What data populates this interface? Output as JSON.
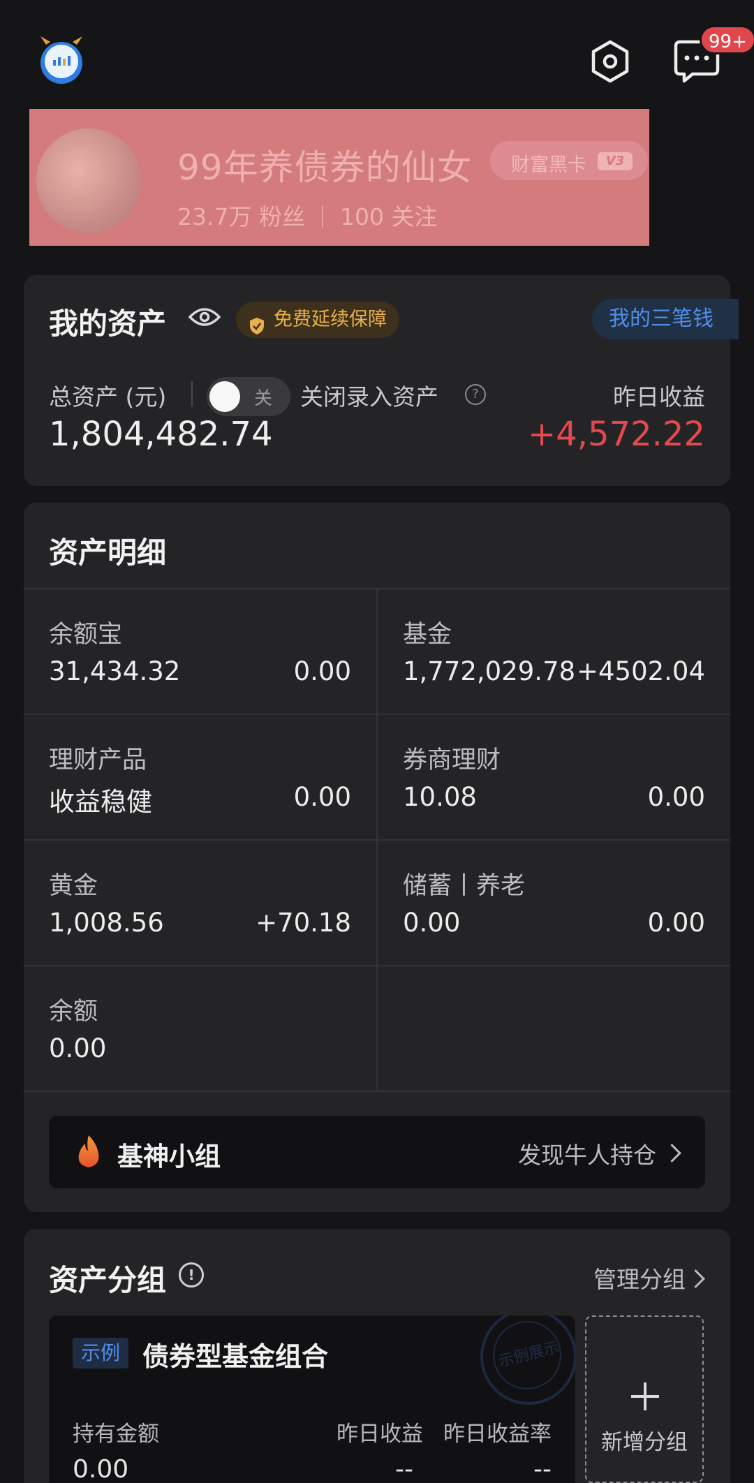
{
  "header": {
    "message_badge": "99+"
  },
  "profile": {
    "name": "99年养债券的仙女",
    "vip_label": "财富黑卡",
    "vip_level": "V3",
    "fans": "23.7万 粉丝",
    "following": "100 关注"
  },
  "assets": {
    "title": "我的资产",
    "guarantee": "免费延续保障",
    "three_money": "我的三笔钱",
    "total_label": "总资产 (元)",
    "toggle_label": "关",
    "toggle_desc": "关闭录入资产",
    "help": "?",
    "total_value": "1,804,482.74",
    "yesterday_label": "昨日收益",
    "yesterday_value": "+4,572.22"
  },
  "detail": {
    "title": "资产明细",
    "items": [
      {
        "label": "余额宝",
        "value": "31,434.32",
        "change": "0.00"
      },
      {
        "label": "基金",
        "value": "1,772,029.78",
        "change": "+4502.04"
      },
      {
        "label": "理财产品",
        "value": "收益稳健",
        "change": "0.00"
      },
      {
        "label": "券商理财",
        "value": "10.08",
        "change": "0.00"
      },
      {
        "label": "黄金",
        "value": "1,008.56",
        "change": "+70.18"
      },
      {
        "label": "储蓄丨养老",
        "value": "0.00",
        "change": "0.00"
      },
      {
        "label": "余额",
        "value": "0.00",
        "change": ""
      }
    ],
    "group_banner": {
      "title": "基神小组",
      "link": "发现牛人持仓"
    }
  },
  "groups": {
    "title": "资产分组",
    "info": "!",
    "manage": "管理分组",
    "example_tag": "示例",
    "example_title": "债券型基金组合",
    "stamp": "示例展示",
    "col_hold": "持有金额",
    "col_yesterday": "昨日收益",
    "col_rate": "昨日收益率",
    "hold_value": "0.00",
    "yesterday_value": "--",
    "rate_value": "--",
    "add_label": "新增分组"
  },
  "colors": {
    "positive": "#e5484d",
    "accent_blue": "#4f8fe8",
    "guard_gold": "#e8b04d",
    "banner": "#d47b7e"
  }
}
